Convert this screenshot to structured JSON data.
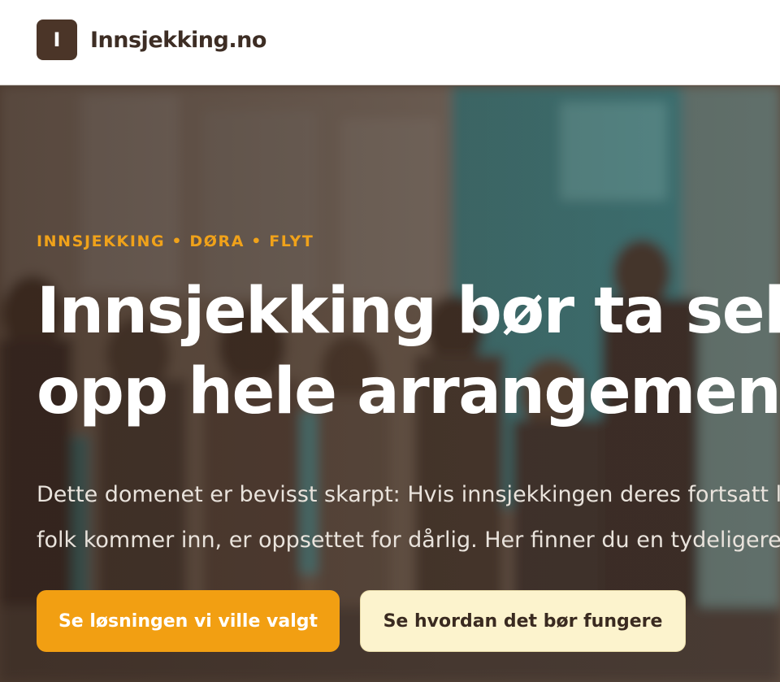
{
  "header": {
    "logo_letter": "I",
    "brand": "Innsjekking.no"
  },
  "hero": {
    "eyebrow": "INNSJEKKING • DØRA • FLYT",
    "headline_line1": "Innsjekking bør ta sekunder, ikke spise",
    "headline_line2": "opp hele arrangementstarten",
    "lede_line1": "Dette domenet er bevisst skarpt: Hvis innsjekkingen deres fortsatt lager kø",
    "lede_line2": "folk kommer inn, er oppsettet for dårlig. Her finner du en tydeligere vei.",
    "primary_cta": "Se løsningen vi ville valgt",
    "secondary_cta": "Se hvordan det bør fungere"
  },
  "colors": {
    "accent": "#f29f12",
    "brand_dark": "#4b3528",
    "secondary_button": "#fcf3cd"
  }
}
